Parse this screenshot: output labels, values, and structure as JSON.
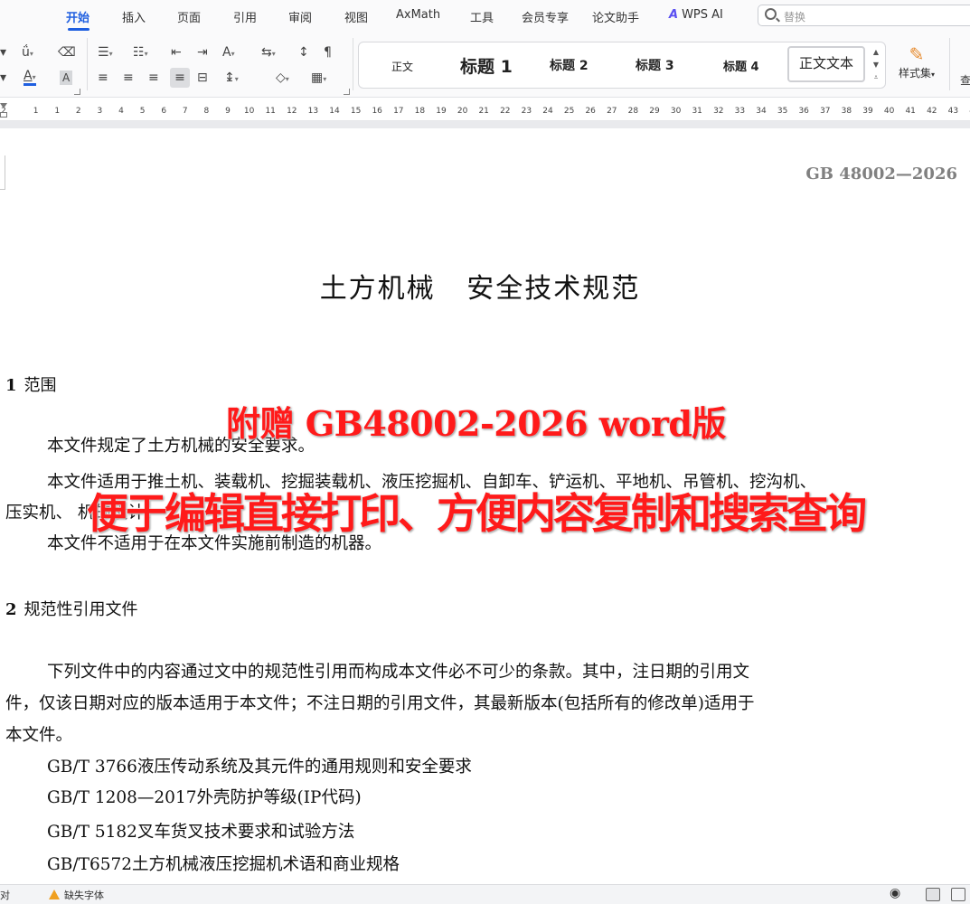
{
  "menu": {
    "tabs": [
      "开始",
      "插入",
      "页面",
      "引用",
      "审阅",
      "视图",
      "AxMath",
      "工具",
      "会员专享",
      "论文助手"
    ],
    "active_tab": "开始",
    "wps_ai_label": "WPS AI",
    "search_placeholder": "替换"
  },
  "ribbon": {
    "styles": [
      "正文",
      "标题 1",
      "标题 2",
      "标题 3",
      "标题 4"
    ],
    "selected_style": "正文文本",
    "style_set_label": "样式集",
    "find_label": "查",
    "font_color": "#1f5fe0",
    "highlight_color": "#9aa0a6"
  },
  "ruler": {
    "numbers": [
      "2",
      "1",
      "1",
      "2",
      "3",
      "4",
      "5",
      "6",
      "7",
      "8",
      "9",
      "10",
      "11",
      "12",
      "13",
      "14",
      "15",
      "16",
      "17",
      "18",
      "19",
      "20",
      "21",
      "22",
      "23",
      "24",
      "25",
      "26",
      "27",
      "28",
      "29",
      "30",
      "31",
      "32",
      "33",
      "34",
      "35",
      "36",
      "37",
      "38",
      "39",
      "40",
      "41",
      "42",
      "43",
      "44"
    ]
  },
  "document": {
    "standard_number": "GB 48002—2026",
    "title": "土方机械   安全技术规范",
    "section1": {
      "number": "1",
      "heading": "范围",
      "para1": "本文件规定了土方机械的安全要求。",
      "para2_line1": "本文件适用于推土机、装载机、挖掘装载机、液压挖掘机、自卸车、铲运机、平地机、吊管机、挖沟机、",
      "para2_line2": "压实机、             机的设计、",
      "para3": "本文件不适用于在本文件实施前制造的机器。"
    },
    "section2": {
      "number": "2",
      "heading": "规范性引用文件",
      "intro_line1": "下列文件中的内容通过文中的规范性引用而构成本文件必不可少的条款。其中，注日期的引用文",
      "intro_line2": "件，仅该日期对应的版本适用于本文件；不注日期的引用文件，其最新版本(包括所有的修改单)适用于",
      "intro_line3": "本文件。",
      "refs": [
        "GB/T 3766液压传动系统及其元件的通用规则和安全要求",
        "GB/T 1208—2017外壳防护等级(IP代码)",
        "GB/T 5182叉车货叉技术要求和试验方法",
        "GB/T6572土方机械液压挖掘机术语和商业规格"
      ]
    }
  },
  "promo": {
    "line1": "附赠 GB48002-2026 word版",
    "line2": "便于编辑直接打印、方便内容复制和搜索查询",
    "color": "#ff1a1a"
  },
  "statusbar": {
    "left_label": "对",
    "missing_font_label": "缺失字体"
  }
}
